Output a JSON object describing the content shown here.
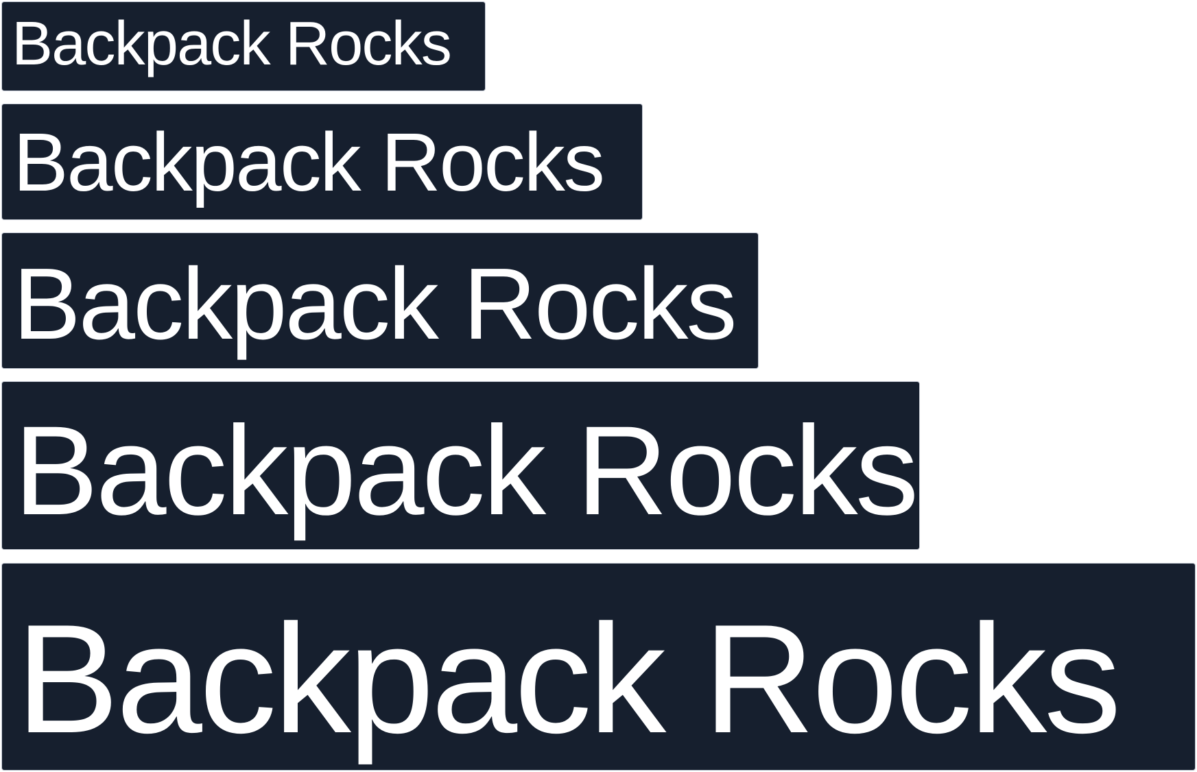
{
  "specimens": [
    {
      "text": "Backpack Rocks"
    },
    {
      "text": "Backpack Rocks"
    },
    {
      "text": "Backpack Rocks"
    },
    {
      "text": "Backpack Rocks"
    },
    {
      "text": "Backpack Rocks"
    }
  ],
  "colors": {
    "background": "#161f2e",
    "text": "#ffffff",
    "border": "#c9ced8"
  }
}
